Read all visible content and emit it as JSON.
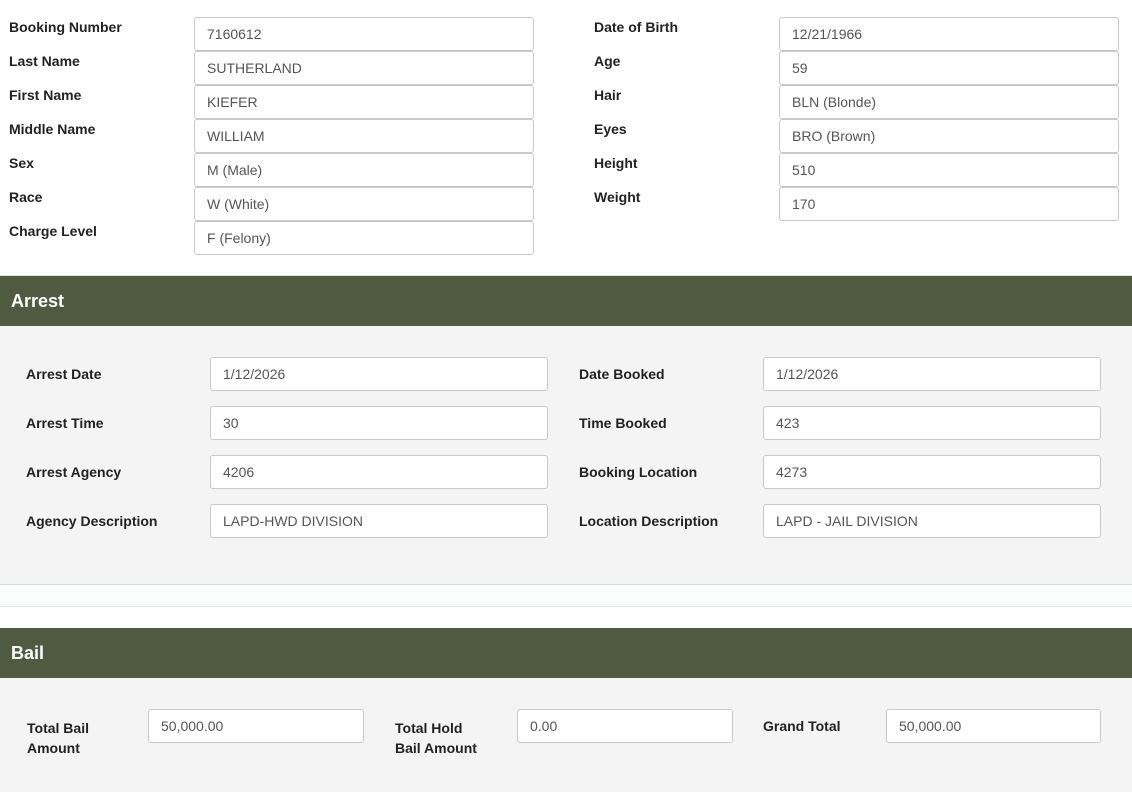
{
  "person": {
    "left": [
      {
        "label": "Booking Number",
        "value": "7160612"
      },
      {
        "label": "Last Name",
        "value": "SUTHERLAND"
      },
      {
        "label": "First Name",
        "value": "KIEFER"
      },
      {
        "label": "Middle Name",
        "value": "WILLIAM"
      },
      {
        "label": "Sex",
        "value": "M (Male)"
      },
      {
        "label": "Race",
        "value": "W (White)"
      },
      {
        "label": "Charge Level",
        "value": "F (Felony)"
      }
    ],
    "right": [
      {
        "label": "Date of Birth",
        "value": "12/21/1966"
      },
      {
        "label": "Age",
        "value": "59"
      },
      {
        "label": "Hair",
        "value": "BLN (Blonde)"
      },
      {
        "label": "Eyes",
        "value": "BRO (Brown)"
      },
      {
        "label": "Height",
        "value": "510"
      },
      {
        "label": "Weight",
        "value": "170"
      }
    ]
  },
  "arrest": {
    "title": "Arrest",
    "left": [
      {
        "label": "Arrest Date",
        "value": "1/12/2026"
      },
      {
        "label": "Arrest Time",
        "value": "30"
      },
      {
        "label": "Arrest Agency",
        "value": "4206"
      },
      {
        "label": "Agency Description",
        "value": "LAPD-HWD DIVISION"
      }
    ],
    "right": [
      {
        "label": "Date Booked",
        "value": "1/12/2026"
      },
      {
        "label": "Time Booked",
        "value": "423"
      },
      {
        "label": "Booking Location",
        "value": "4273"
      },
      {
        "label": "Location Description",
        "value": "LAPD - JAIL DIVISION"
      }
    ]
  },
  "bail": {
    "title": "Bail",
    "total_bail": {
      "label_line1": "Total Bail",
      "label_line2": "Amount",
      "value": "50,000.00"
    },
    "total_hold": {
      "label_line1": "Total Hold",
      "label_line2": "Bail Amount",
      "value": "0.00"
    },
    "grand_total": {
      "label": "Grand Total",
      "value": "50,000.00"
    }
  },
  "colors": {
    "section_header": "#4f5a40",
    "panel": "#f4f4f4"
  }
}
